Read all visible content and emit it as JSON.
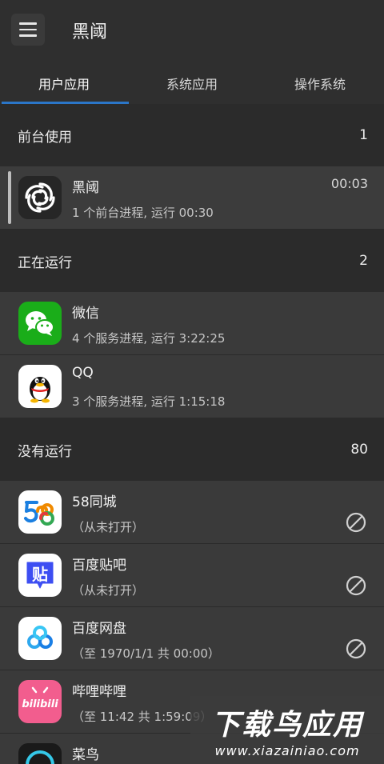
{
  "toolbar": {
    "title": "黑阈",
    "menu_icon": "hamburger-menu-icon"
  },
  "tabs": [
    {
      "label": "用户应用",
      "active": true
    },
    {
      "label": "系统应用",
      "active": false
    },
    {
      "label": "操作系统",
      "active": false
    }
  ],
  "sections": {
    "foreground": {
      "label": "前台使用",
      "count": "1"
    },
    "running": {
      "label": "正在运行",
      "count": "2"
    },
    "not_running": {
      "label": "没有运行",
      "count": "80"
    }
  },
  "apps": {
    "heiyu": {
      "name": "黑阈",
      "sub": "1 个前台进程, 运行 00:30",
      "time": "00:03",
      "icon": "heiyu-swirl-icon"
    },
    "wechat": {
      "name": "微信",
      "sub": "4 个服务进程, 运行 3:22:25",
      "icon": "wechat-icon",
      "color": "#1aad19"
    },
    "qq": {
      "name": "QQ",
      "sub": "3 个服务进程, 运行 1:15:18",
      "icon": "qq-penguin-icon"
    },
    "city58": {
      "name": "58同城",
      "sub": "（从未打开）",
      "icon": "58-logo-icon"
    },
    "tieba": {
      "name": "百度贴吧",
      "sub": "（从未打开）",
      "icon": "tieba-icon",
      "color": "#3d4ef2"
    },
    "netdisk": {
      "name": "百度网盘",
      "sub": "（至 1970/1/1 共 00:00）",
      "icon": "netdisk-icon"
    },
    "bilibili": {
      "name": "哔哩哔哩",
      "sub": "（至 11:42 共 1:59:09）",
      "icon": "bilibili-icon",
      "color": "#f25d8e"
    },
    "cainiao": {
      "name": "菜鸟",
      "icon": "cainiao-icon"
    }
  },
  "watermark": {
    "main": "下载鸟应用",
    "sub": "www.xiazainiao.com"
  }
}
